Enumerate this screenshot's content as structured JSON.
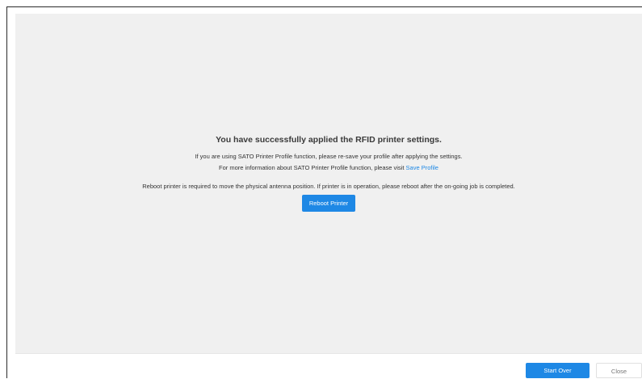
{
  "message": {
    "title": "You have successfully applied the RFID printer settings.",
    "profile_line1": "If you are using SATO Printer Profile function, please re-save your profile after applying the settings.",
    "profile_line2_prefix": "For more information about SATO Printer Profile function, please visit",
    "save_profile_link": "Save Profile",
    "reboot_note": "Reboot printer is required to move the physical antenna position. If printer is in operation, please reboot after the on-going job is completed.",
    "reboot_button": "Reboot Printer"
  },
  "footer": {
    "start_over": "Start Over",
    "close": "Close"
  },
  "colors": {
    "accent": "#1e88e5",
    "panel_background": "#f0f0f0"
  }
}
